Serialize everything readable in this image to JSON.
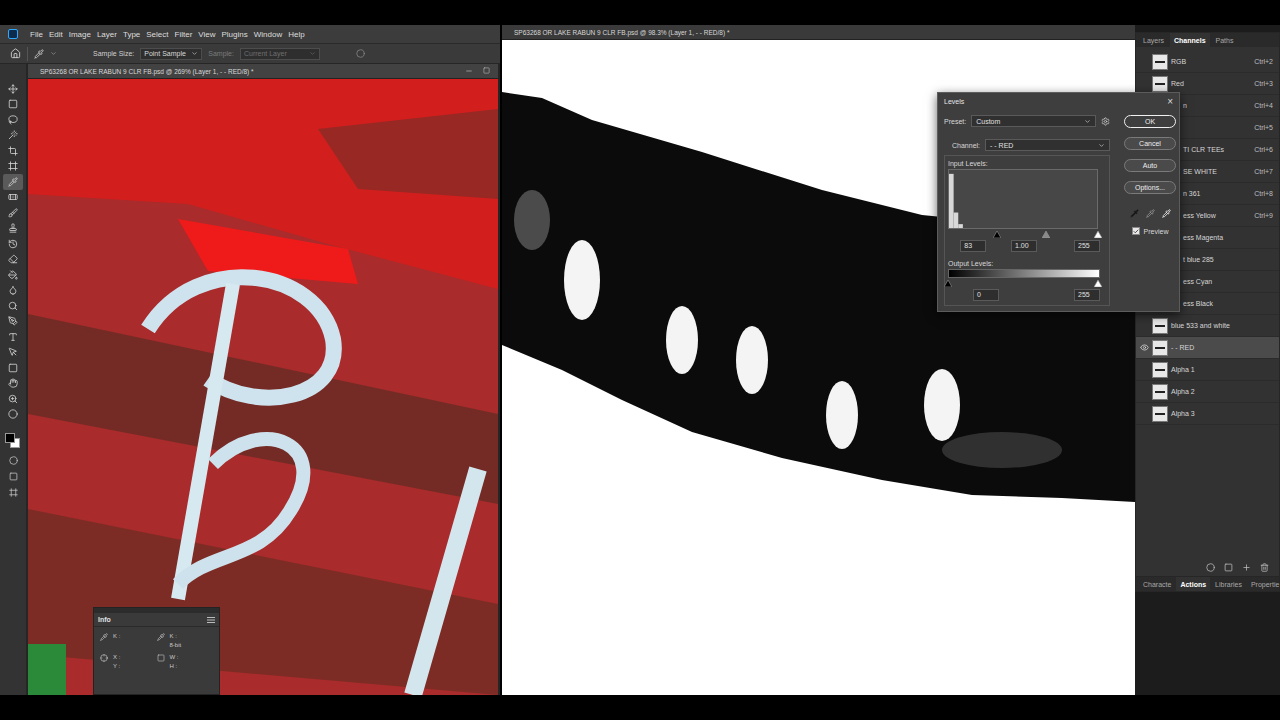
{
  "menu": [
    "File",
    "Edit",
    "Image",
    "Layer",
    "Type",
    "Select",
    "Filter",
    "View",
    "Plugins",
    "Window",
    "Help"
  ],
  "options_bar": {
    "sample_size_label": "Sample Size:",
    "sample_size": "Point Sample",
    "sample_label": "Sample:",
    "sample": "Current Layer",
    "sample_disabled": true
  },
  "tools": [
    {
      "selected": false
    },
    {
      "selected": false
    },
    {
      "selected": false
    },
    {
      "selected": false
    },
    {
      "selected": false
    },
    {
      "selected": false
    },
    {
      "selected": true
    },
    {
      "selected": false
    },
    {
      "selected": false
    },
    {
      "selected": false
    },
    {
      "selected": false
    },
    {
      "selected": false
    },
    {
      "selected": false
    },
    {
      "selected": false
    },
    {
      "selected": false
    },
    {
      "selected": false
    },
    {
      "selected": false
    },
    {
      "selected": false
    },
    {
      "selected": false
    },
    {
      "selected": false
    },
    {
      "selected": false
    },
    {
      "selected": false
    }
  ],
  "documents": [
    {
      "title": "SP63268 OR LAKE RABUN 9 CLR FB.psd @ 269% (Layer 1, - - RED/8) *"
    },
    {
      "title": "SP63268 OR LAKE RABUN 9 CLR FB.psd @ 98.3% (Layer 1, - - RED/8) *"
    }
  ],
  "info_panel": {
    "title": "Info",
    "readouts": [
      {
        "label": "K :"
      },
      {
        "label": "K :"
      }
    ],
    "bit_depth": "8-bit",
    "position": [
      "X :",
      "Y :"
    ],
    "size": [
      "W :",
      "H :"
    ]
  },
  "levels_dialog": {
    "title": "Levels",
    "close": "×",
    "preset_label": "Preset:",
    "preset": "Custom",
    "channel_label": "Channel:",
    "channel": "- - RED",
    "input_label": "Input Levels:",
    "histogram": [
      14,
      4,
      1,
      0,
      0,
      0,
      0,
      0,
      0,
      0,
      0,
      0,
      0,
      0,
      0,
      0,
      0,
      0,
      0,
      0,
      0,
      0,
      0,
      0,
      0,
      0,
      0,
      0,
      0,
      0,
      0,
      0
    ],
    "input_levels": [
      {
        "value": "83",
        "level": 0.325
      },
      {
        "value": "1.00",
        "level": 0.65
      },
      {
        "value": "255",
        "level": 1
      }
    ],
    "output_label": "Output Levels:",
    "output_levels": [
      {
        "value": "0",
        "level": 0
      },
      {
        "value": "255",
        "level": 1
      }
    ],
    "buttons": [
      {
        "label": "OK",
        "selected": true
      },
      {
        "label": "Cancel",
        "selected": false
      },
      {
        "label": "Auto",
        "selected": false
      },
      {
        "label": "Options...",
        "selected": false
      }
    ],
    "preview": {
      "label": "Preview",
      "checked": true
    }
  },
  "channels_panel": {
    "tabs": [
      {
        "label": "Layers",
        "selected": false
      },
      {
        "label": "Channels",
        "selected": true
      },
      {
        "label": "Paths",
        "selected": false
      }
    ],
    "channels": [
      {
        "name": "RGB",
        "shortcut": "Ctrl+2",
        "visible": false,
        "selected": false,
        "covered": false
      },
      {
        "name": "Red",
        "shortcut": "Ctrl+3",
        "visible": false,
        "selected": false,
        "covered": false
      },
      {
        "name": "n",
        "shortcut": "Ctrl+4",
        "visible": false,
        "selected": false,
        "covered": true
      },
      {
        "name": "",
        "shortcut": "Ctrl+5",
        "visible": false,
        "selected": false,
        "covered": true
      },
      {
        "name": "TI CLR TEEs",
        "shortcut": "Ctrl+6",
        "visible": false,
        "selected": false,
        "covered": true
      },
      {
        "name": "SE WHITE",
        "shortcut": "Ctrl+7",
        "visible": false,
        "selected": false,
        "covered": true
      },
      {
        "name": "n 361",
        "shortcut": "Ctrl+8",
        "visible": false,
        "selected": false,
        "covered": true
      },
      {
        "name": "ess Yellow",
        "shortcut": "Ctrl+9",
        "visible": false,
        "selected": false,
        "covered": true
      },
      {
        "name": "ess Magenta",
        "visible": false,
        "selected": false,
        "covered": true
      },
      {
        "name": "t blue 285",
        "visible": false,
        "selected": false,
        "covered": true
      },
      {
        "name": "ess Cyan",
        "visible": false,
        "selected": false,
        "covered": true
      },
      {
        "name": "ess Black",
        "visible": false,
        "selected": false,
        "covered": true
      },
      {
        "name": "blue 533 and white",
        "visible": false,
        "selected": false,
        "covered": false
      },
      {
        "name": "- - RED",
        "visible": true,
        "selected": true,
        "covered": false
      },
      {
        "name": "Alpha 1",
        "visible": false,
        "selected": false,
        "covered": false
      },
      {
        "name": "Alpha 2",
        "visible": false,
        "selected": false,
        "covered": false
      },
      {
        "name": "Alpha 3",
        "visible": false,
        "selected": false,
        "covered": false
      }
    ],
    "bottom_tabs": [
      {
        "label": "Characte",
        "selected": false
      },
      {
        "label": "Actions",
        "selected": true
      },
      {
        "label": "Libraries",
        "selected": false
      },
      {
        "label": "Propertie",
        "selected": false
      }
    ]
  }
}
